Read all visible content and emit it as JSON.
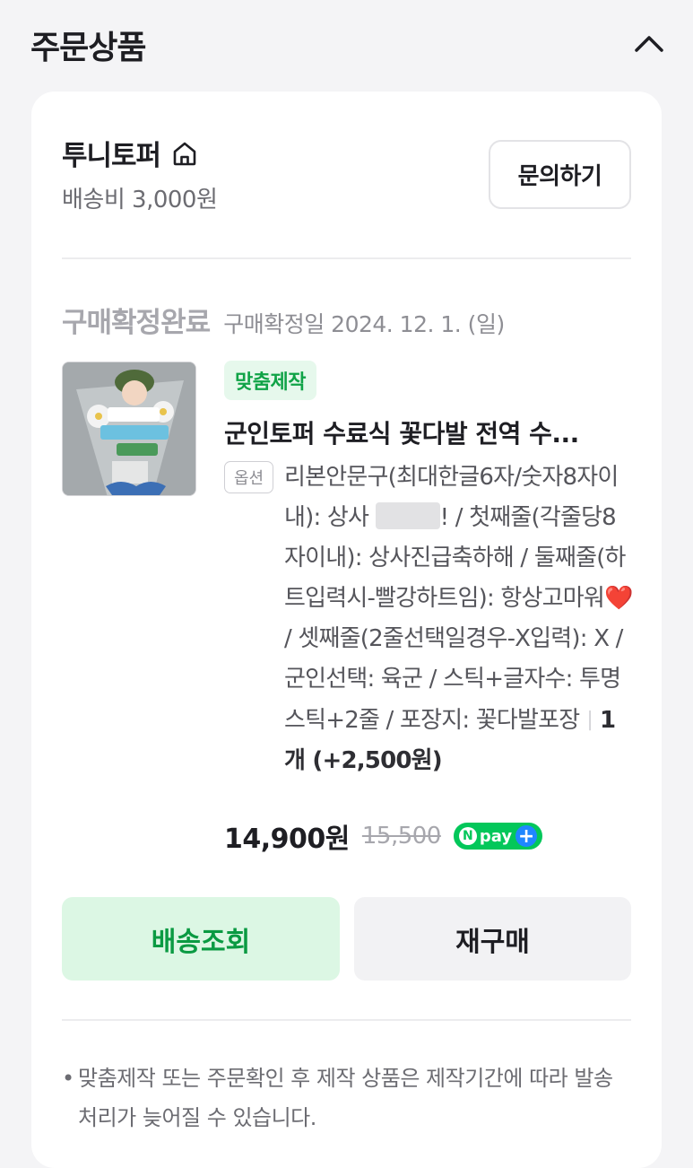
{
  "section": {
    "title": "주문상품"
  },
  "seller": {
    "name": "투니토퍼",
    "shipping_fee": "배송비 3,000원",
    "inquiry_label": "문의하기"
  },
  "order": {
    "status": "구매확정완료",
    "confirm_date": "구매확정일 2024. 12. 1. (일)"
  },
  "product": {
    "tag": "맞춤제작",
    "title": "군인토퍼 수료식 꽃다발 전역 수...",
    "option_label": "옵션",
    "option_part1": "리본안문구(최대한글6자/숫자8자이내): 상사",
    "option_part2": "! / 첫째줄(각줄당8자이내): 상사진급축하해 / 둘째줄(하트입력시-빨강하트임): 항상고마워",
    "option_heart": "❤️",
    "option_part3": " / 셋째줄(2줄선택일경우-X입력): X / 군인선택: 육군 / 스틱+글자수: 투명스틱+2줄 / 포장지: 꽃다발포장",
    "quantity": "1개 (+2,500원)",
    "price_sale": "14,900원",
    "price_original": "15,500",
    "npay_label": "pay"
  },
  "actions": {
    "track_label": "배송조회",
    "rebuy_label": "재구매"
  },
  "notice": {
    "text": "맞춤제작 또는 주문확인 후 제작 상품은 제작기간에 따라 발송 처리가 늦어질 수 있습니다."
  },
  "colors": {
    "accent_green": "#03c75a",
    "npay_plus_blue": "#1f87ff"
  }
}
